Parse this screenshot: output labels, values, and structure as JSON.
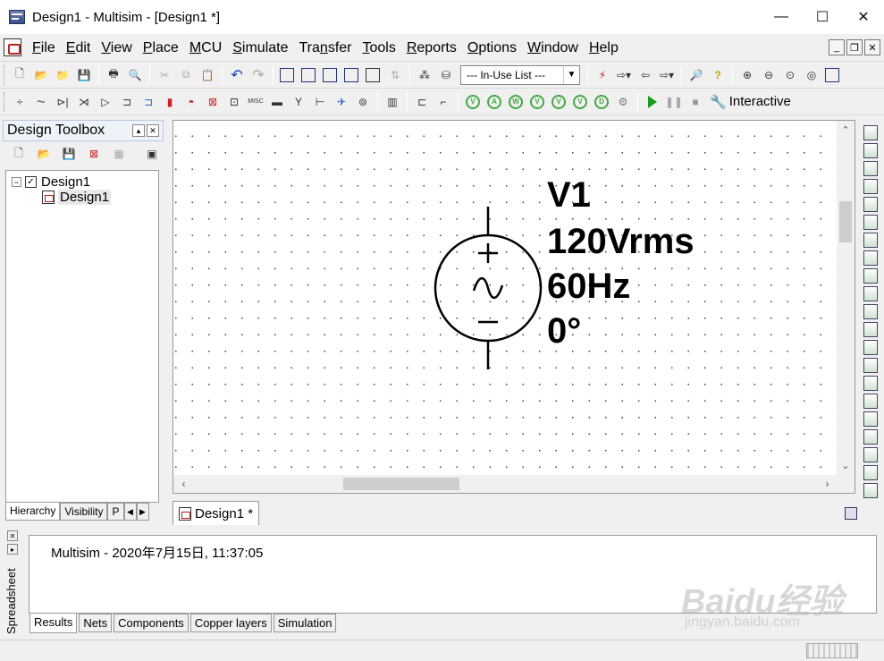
{
  "window": {
    "title": "Design1 - Multisim - [Design1 *]",
    "minimize": "—",
    "maximize": "☐",
    "close": "✕"
  },
  "menu": [
    {
      "pre": "",
      "ul": "F",
      "post": "ile"
    },
    {
      "pre": "",
      "ul": "E",
      "post": "dit"
    },
    {
      "pre": "",
      "ul": "V",
      "post": "iew"
    },
    {
      "pre": "",
      "ul": "P",
      "post": "lace"
    },
    {
      "pre": "",
      "ul": "M",
      "post": "CU"
    },
    {
      "pre": "",
      "ul": "S",
      "post": "imulate"
    },
    {
      "pre": "Tra",
      "ul": "n",
      "post": "sfer"
    },
    {
      "pre": "",
      "ul": "T",
      "post": "ools"
    },
    {
      "pre": "",
      "ul": "R",
      "post": "eports"
    },
    {
      "pre": "",
      "ul": "O",
      "post": "ptions"
    },
    {
      "pre": "",
      "ul": "W",
      "post": "indow"
    },
    {
      "pre": "",
      "ul": "H",
      "post": "elp"
    }
  ],
  "toolbar": {
    "inuse_list": "--- In-Use List ---",
    "interactive_label": "Interactive"
  },
  "toolbox": {
    "title": "Design Toolbox",
    "tree": {
      "root": "Design1",
      "child": "Design1"
    },
    "tabs": [
      "Hierarchy",
      "Visibility",
      "P"
    ]
  },
  "canvas": {
    "source": {
      "name": "V1",
      "voltage": "120Vrms",
      "frequency": "60Hz",
      "phase": "0°"
    }
  },
  "document_tab": "Design1 *",
  "spreadsheet": {
    "side_label": "Spreadsheet",
    "log": "Multisim  -  2020年7月15日, 11:37:05",
    "tabs": [
      "Results",
      "Nets",
      "Components",
      "Copper layers",
      "Simulation"
    ]
  },
  "watermark": {
    "brand": "Baidu经验",
    "url": "jingyan.baidu.com"
  },
  "colors": {
    "accent_green": "#1a9a1a",
    "icon_red": "#b22222"
  }
}
